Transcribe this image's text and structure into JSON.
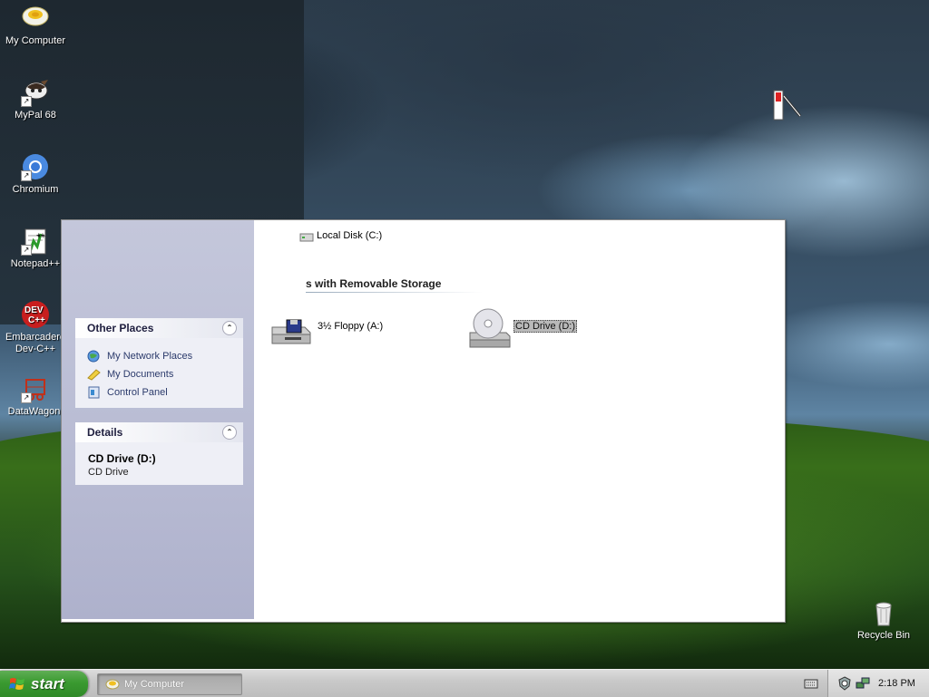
{
  "desktop": {
    "icons": [
      {
        "label": "My Computer",
        "icon": "my-computer-icon"
      },
      {
        "label": "MyPal 68",
        "icon": "mypal-icon"
      },
      {
        "label": "Chromium",
        "icon": "chromium-icon"
      },
      {
        "label": "Notepad++",
        "icon": "notepad-plus-plus-icon"
      },
      {
        "label": "Embarcadero Dev-C++",
        "icon": "devcpp-icon"
      },
      {
        "label": "DataWagon.",
        "icon": "datawagon-icon"
      },
      {
        "label": "Recycle Bin",
        "icon": "recycle-bin-icon"
      }
    ]
  },
  "window": {
    "hard_disks": [
      {
        "label": "Local Disk (C:)",
        "icon": "hard-disk-icon"
      }
    ],
    "removable_section_title": "s with Removable Storage",
    "removable": [
      {
        "label": "3½ Floppy (A:)",
        "icon": "floppy-drive-icon"
      },
      {
        "label": "CD Drive (D:)",
        "icon": "cd-drive-icon",
        "selected": true
      }
    ],
    "other_places": {
      "title": "Other Places",
      "items": [
        {
          "label": "My Network Places",
          "icon": "network-places-icon"
        },
        {
          "label": "My Documents",
          "icon": "my-documents-icon"
        },
        {
          "label": "Control Panel",
          "icon": "control-panel-icon"
        }
      ]
    },
    "details": {
      "title": "Details",
      "name": "CD Drive (D:)",
      "type": "CD Drive"
    }
  },
  "taskbar": {
    "start_label": "start",
    "task_button_label": "My Computer",
    "clock": "2:18 PM"
  },
  "colors": {
    "taskpane": "#b8bbd3",
    "start_green": "#3a9a30",
    "selection": "#b9b9b9"
  }
}
